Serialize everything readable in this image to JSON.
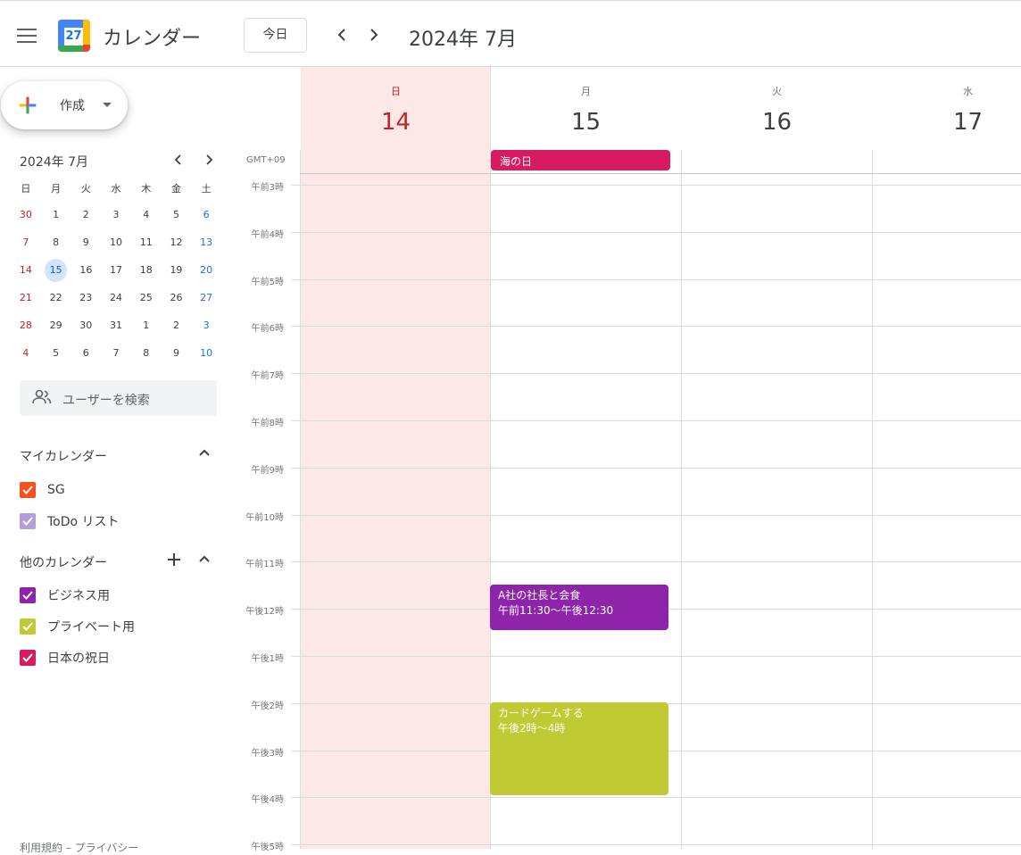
{
  "app": {
    "title": "カレンダー",
    "logo_day": "27"
  },
  "toolbar": {
    "today_label": "今日",
    "prev": "‹",
    "next": "›",
    "current_period": "2024年 7月"
  },
  "create": {
    "label": "作成"
  },
  "mini_calendar": {
    "title": "2024年 7月",
    "prev": "‹",
    "next": "›",
    "weekdays": [
      "日",
      "月",
      "火",
      "水",
      "木",
      "金",
      "土"
    ],
    "weeks": [
      [
        "30",
        "1",
        "2",
        "3",
        "4",
        "5",
        "6"
      ],
      [
        "7",
        "8",
        "9",
        "10",
        "11",
        "12",
        "13"
      ],
      [
        "14",
        "15",
        "16",
        "17",
        "18",
        "19",
        "20"
      ],
      [
        "21",
        "22",
        "23",
        "24",
        "25",
        "26",
        "27"
      ],
      [
        "28",
        "29",
        "30",
        "31",
        "1",
        "2",
        "3"
      ],
      [
        "4",
        "5",
        "6",
        "7",
        "8",
        "9",
        "10"
      ]
    ],
    "selected": "15"
  },
  "search_users": {
    "placeholder": "ユーザーを検索"
  },
  "my_calendars": {
    "heading": "マイカレンダー",
    "items": [
      {
        "label": "SG",
        "color": "#f4511e"
      },
      {
        "label": "ToDo リスト",
        "color": "#b39ddb"
      }
    ]
  },
  "other_calendars": {
    "heading": "他のカレンダー",
    "items": [
      {
        "label": "ビジネス用",
        "color": "#8e24aa"
      },
      {
        "label": "プライベート用",
        "color": "#c0ca33"
      },
      {
        "label": "日本の祝日",
        "color": "#d81b60"
      }
    ]
  },
  "footer": {
    "text": "利用規約 – プライバシー"
  },
  "week_view": {
    "timezone": "GMT+09",
    "days": [
      {
        "dow": "日",
        "num": "14",
        "today": true
      },
      {
        "dow": "月",
        "num": "15",
        "today": false
      },
      {
        "dow": "火",
        "num": "16",
        "today": false
      },
      {
        "dow": "水",
        "num": "17",
        "today": false
      }
    ],
    "hours": [
      "午前3時",
      "午前4時",
      "午前5時",
      "午前6時",
      "午前7時",
      "午前8時",
      "午前9時",
      "午前10時",
      "午前11時",
      "午後12時",
      "午後1時",
      "午後2時",
      "午後3時",
      "午後4時",
      "午後5時"
    ],
    "all_day_events": [
      {
        "title": "海の日",
        "day": "15",
        "color": "#d81b60"
      }
    ],
    "events": [
      {
        "title": "A社の社長と会食",
        "time": "午前11:30〜午後12:30",
        "day": "15",
        "color": "#8e24aa"
      },
      {
        "title": "カードゲームする",
        "time": "午後2時〜4時",
        "day": "15",
        "color": "#c0ca33"
      }
    ]
  }
}
